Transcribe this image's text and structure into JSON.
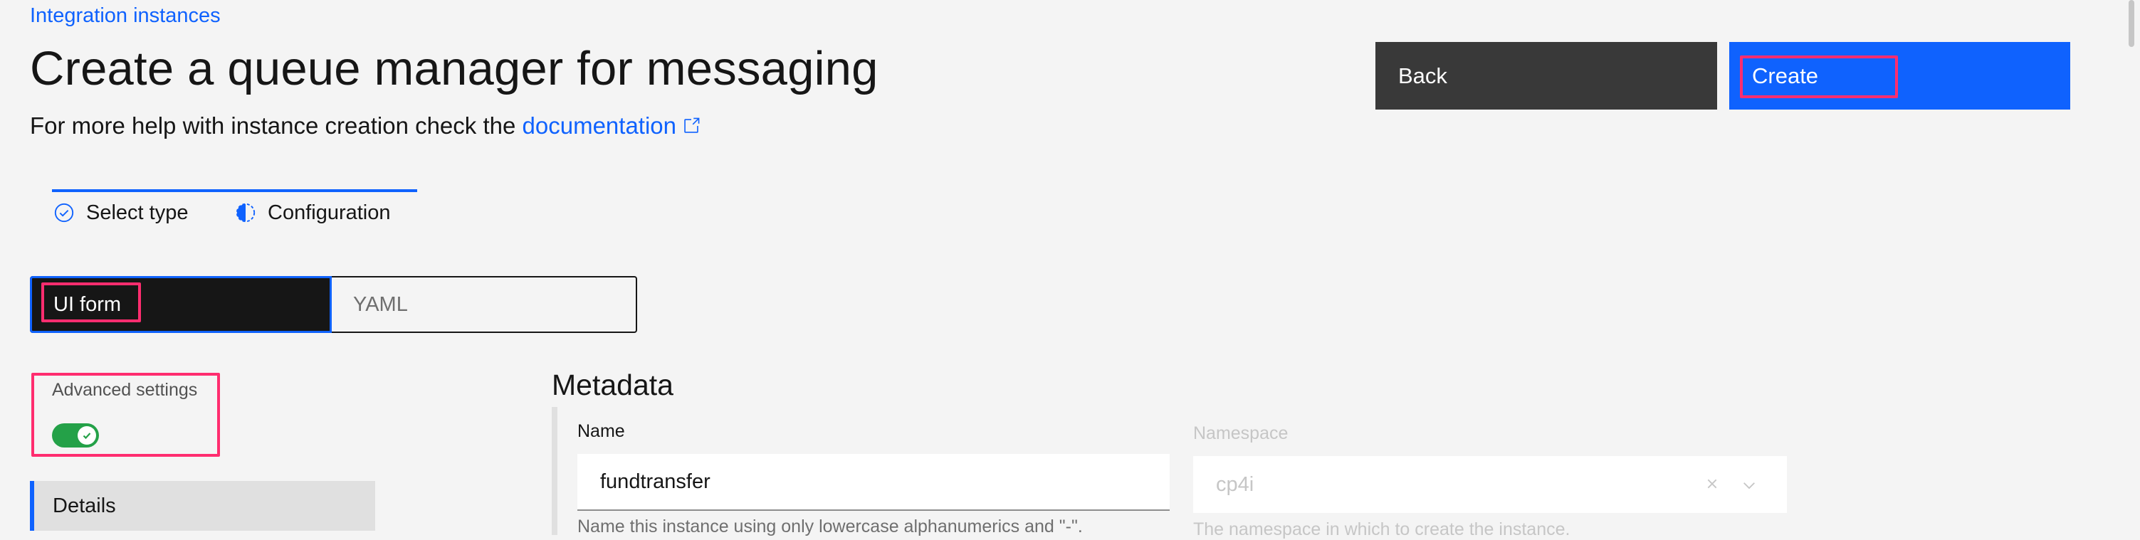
{
  "breadcrumb": {
    "label": "Integration instances"
  },
  "header": {
    "title": "Create a queue manager for messaging",
    "help_text": "For more help with instance creation check the",
    "help_link": "documentation",
    "back_label": "Back",
    "create_label": "Create"
  },
  "steps": [
    {
      "label": "Select type",
      "state": "complete",
      "icon": "checkmark-outline-icon"
    },
    {
      "label": "Configuration",
      "state": "current",
      "icon": "incomplete-half-icon"
    }
  ],
  "mode_switcher": {
    "options": [
      "UI form",
      "YAML"
    ],
    "selected": "UI form"
  },
  "advanced_settings": {
    "label": "Advanced settings",
    "enabled": true
  },
  "sidenav": {
    "items": [
      {
        "label": "Details",
        "active": true
      }
    ]
  },
  "metadata": {
    "title": "Metadata",
    "name": {
      "label": "Name",
      "value": "fundtransfer",
      "helper": "Name this instance using only lowercase alphanumerics and \"-\"."
    },
    "namespace": {
      "label": "Namespace",
      "value": "cp4i",
      "helper": "The namespace in which to create the instance.",
      "disabled": true
    }
  },
  "colors": {
    "link": "#0f62fe",
    "primary_button": "#0f62fe",
    "secondary_button": "#393939",
    "toggle_on": "#24a148",
    "highlight": "#ff2d6f"
  }
}
